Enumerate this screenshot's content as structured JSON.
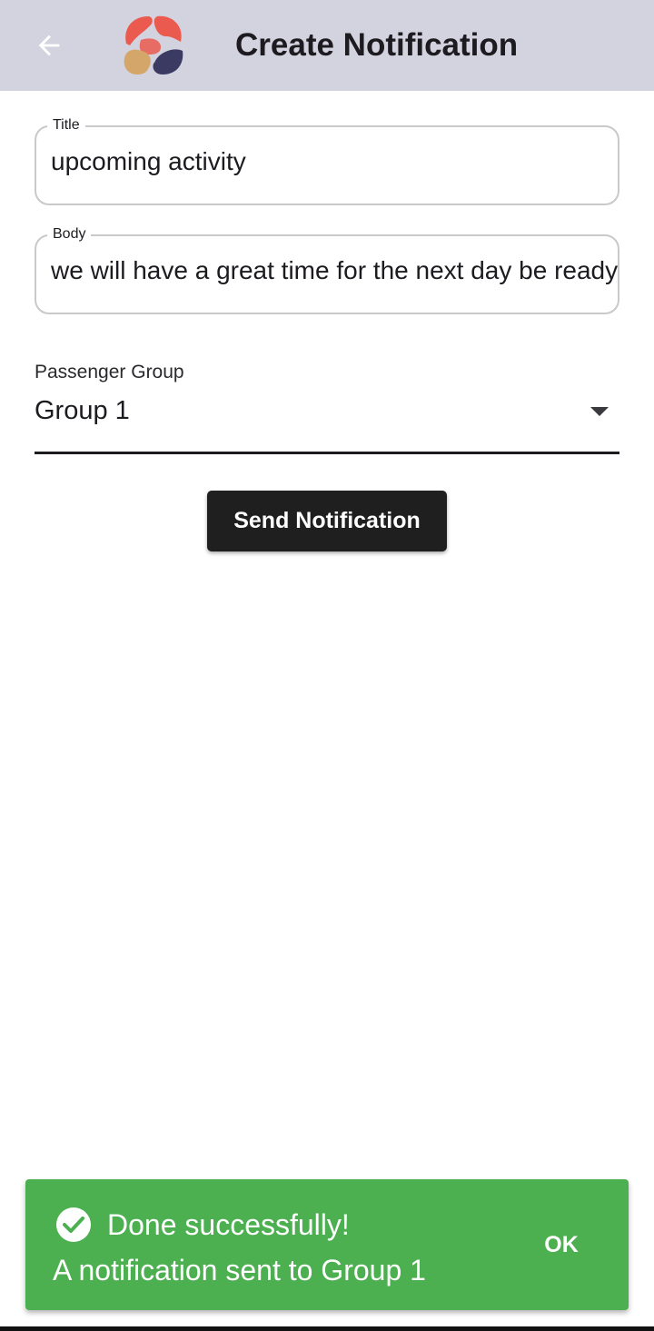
{
  "header": {
    "title": "Create Notification",
    "back_icon": "arrow-left-icon",
    "logo": "app-logo"
  },
  "form": {
    "title_field": {
      "label": "Title",
      "value": "upcoming activity"
    },
    "body_field": {
      "label": "Body",
      "value": "we will have a great time for the next day be ready"
    },
    "passenger_group": {
      "label": "Passenger Group",
      "selected": "Group 1",
      "arrow_icon": "dropdown-arrow-icon"
    },
    "send_button": "Send Notification"
  },
  "toast": {
    "icon": "check-circle-icon",
    "title": "Done successfully!",
    "message": "A notification sent to Group 1",
    "action": "OK"
  },
  "colors": {
    "appbar": "#d3d3df",
    "button": "#1f1f1f",
    "toast": "#4caf50",
    "logo_red": "#ea5a4f",
    "logo_gold": "#d4a66a",
    "logo_navy": "#3b3a63"
  }
}
